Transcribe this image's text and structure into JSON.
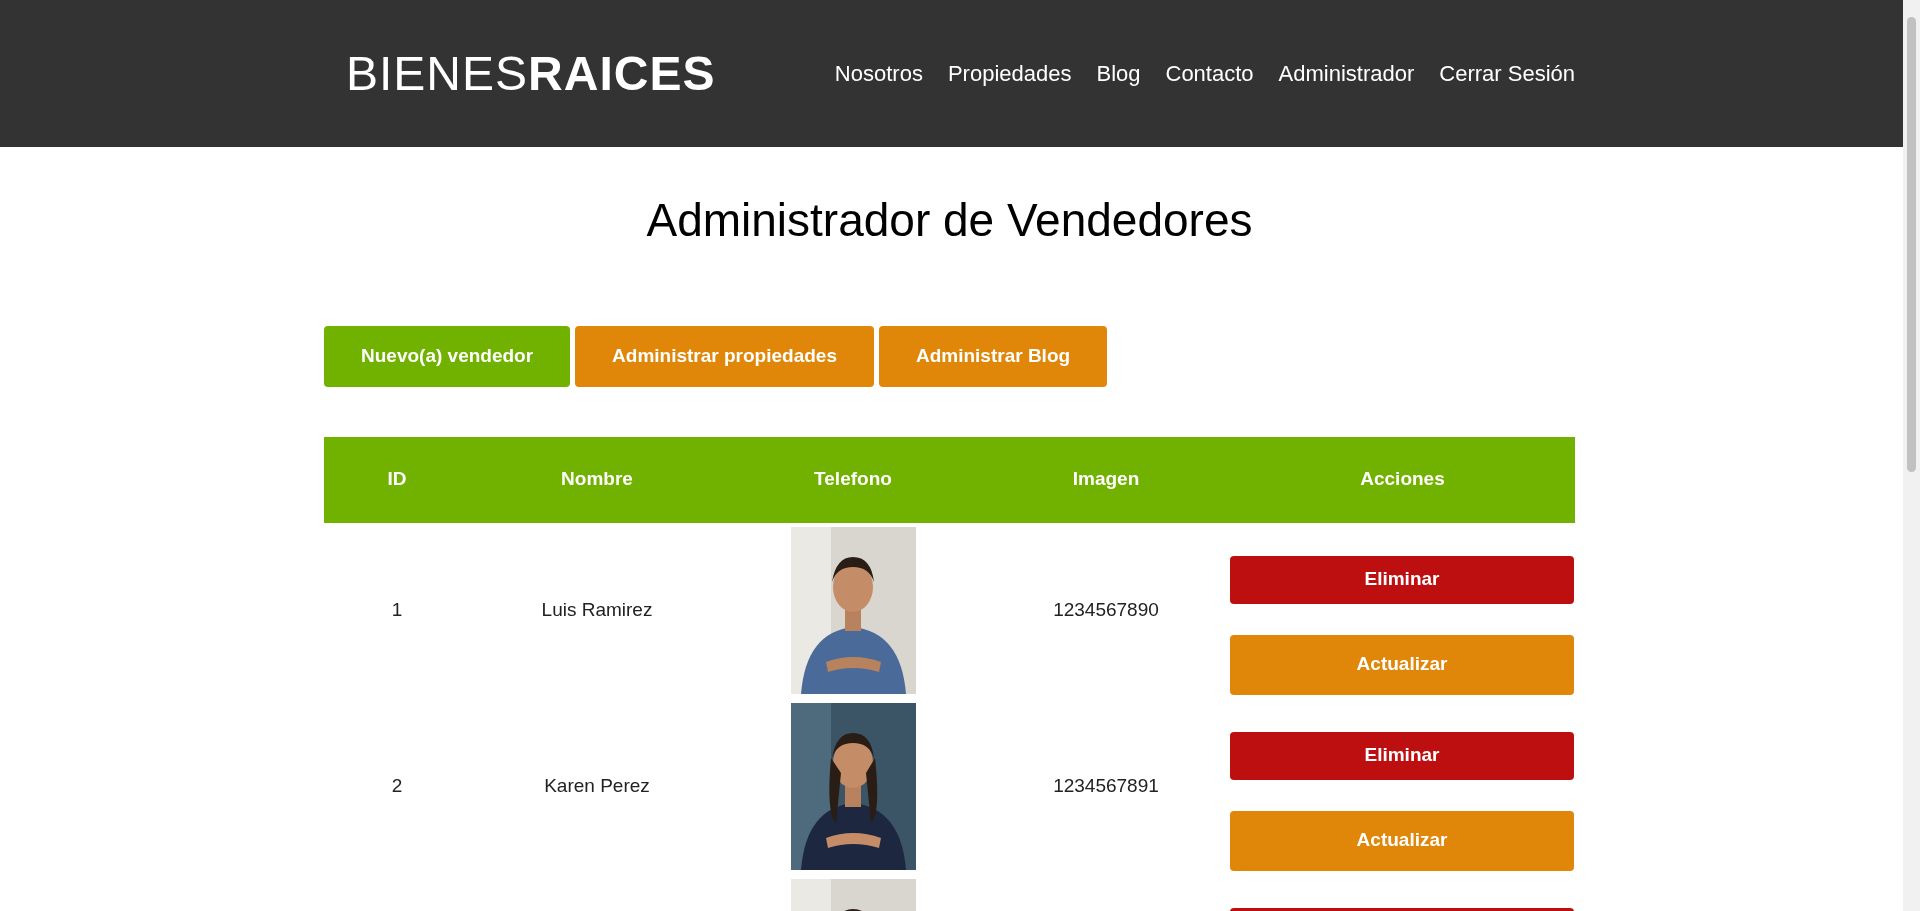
{
  "header": {
    "logo": {
      "light": "BIENES",
      "bold": "RAICES"
    },
    "nav": [
      "Nosotros",
      "Propiedades",
      "Blog",
      "Contacto",
      "Administrador",
      "Cerrar Sesión"
    ]
  },
  "title": "Administrador de Vendedores",
  "actions": [
    {
      "label": "Nuevo(a) vendedor",
      "kind": "primary"
    },
    {
      "label": "Administrar propiedades",
      "kind": "secondary"
    },
    {
      "label": "Administrar Blog",
      "kind": "secondary"
    }
  ],
  "table": {
    "columns": [
      "ID",
      "Nombre",
      "Telefono",
      "Imagen",
      "Acciones"
    ],
    "rows": [
      {
        "id": "1",
        "name": "Luis Ramirez",
        "photo": {
          "kind": "picture"
        },
        "phone": "1234567890",
        "buttons": [
          {
            "label": "Eliminar",
            "kind": "delete"
          },
          {
            "label": "Actualizar",
            "kind": "update"
          }
        ]
      },
      {
        "id": "2",
        "name": "Karen Perez",
        "photo": {
          "kind": "picture"
        },
        "phone": "1234567891",
        "buttons": [
          {
            "label": "Eliminar",
            "kind": "delete"
          },
          {
            "label": "Actualizar",
            "kind": "update"
          }
        ]
      },
      {
        "photo": {
          "kind": "picture"
        },
        "buttons": [
          {
            "kind": "delete"
          }
        ]
      }
    ]
  }
}
